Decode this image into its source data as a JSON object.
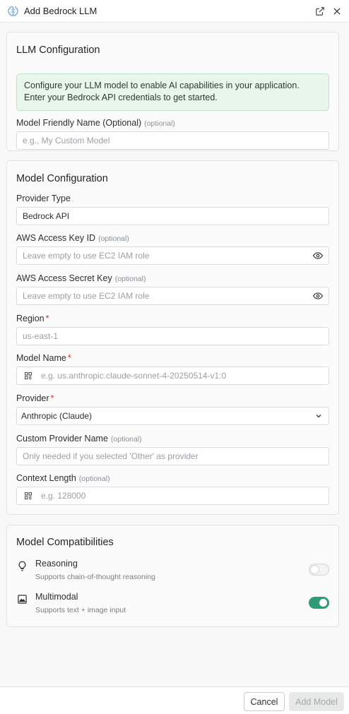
{
  "window": {
    "title": "Add Bedrock LLM",
    "logo_icon": "brain-icon",
    "actions": [
      "external-link-icon",
      "close-icon"
    ]
  },
  "llm_config": {
    "title": "LLM Configuration",
    "info_text": "Configure your LLM model to enable AI capabilities in your application. Enter your Bedrock API credentials to get started.",
    "friendly_name": {
      "label": "Model Friendly Name (Optional)",
      "optional": "(optional)",
      "placeholder": "e.g., My Custom Model"
    }
  },
  "model_config": {
    "title": "Model Configuration",
    "provider_type": {
      "label": "Provider Type",
      "value": "Bedrock API"
    },
    "access_key": {
      "label": "AWS Access Key ID",
      "optional": "(optional)",
      "placeholder": "Leave empty to use EC2 IAM role"
    },
    "secret_key": {
      "label": "AWS Access Secret Key",
      "optional": "(optional)",
      "placeholder": "Leave empty to use EC2 IAM role"
    },
    "region": {
      "label": "Region",
      "required": "*",
      "value": "us-east-1"
    },
    "model_name": {
      "label": "Model Name",
      "required": "*",
      "placeholder": "e.g. us.anthropic.claude-sonnet-4-20250514-v1:0"
    },
    "provider": {
      "label": "Provider",
      "required": "*",
      "value": "Anthropic (Claude)"
    },
    "custom_provider": {
      "label": "Custom Provider Name",
      "optional": "(optional)",
      "placeholder": "Only needed if you selected 'Other' as provider"
    },
    "context_length": {
      "label": "Context Length",
      "optional": "(optional)",
      "placeholder": "e.g. 128000"
    }
  },
  "compat": {
    "title": "Model Compatibilities",
    "reasoning": {
      "name": "Reasoning",
      "desc": "Supports chain-of-thought reasoning",
      "enabled": false
    },
    "multimodal": {
      "name": "Multimodal",
      "desc": "Supports text + image input",
      "enabled": true
    }
  },
  "footer": {
    "cancel_label": "Cancel",
    "add_label": "Add Model"
  },
  "colors": {
    "accent": "#2e9c78",
    "info_bg": "#e9f6ec",
    "required": "#d0312d"
  }
}
